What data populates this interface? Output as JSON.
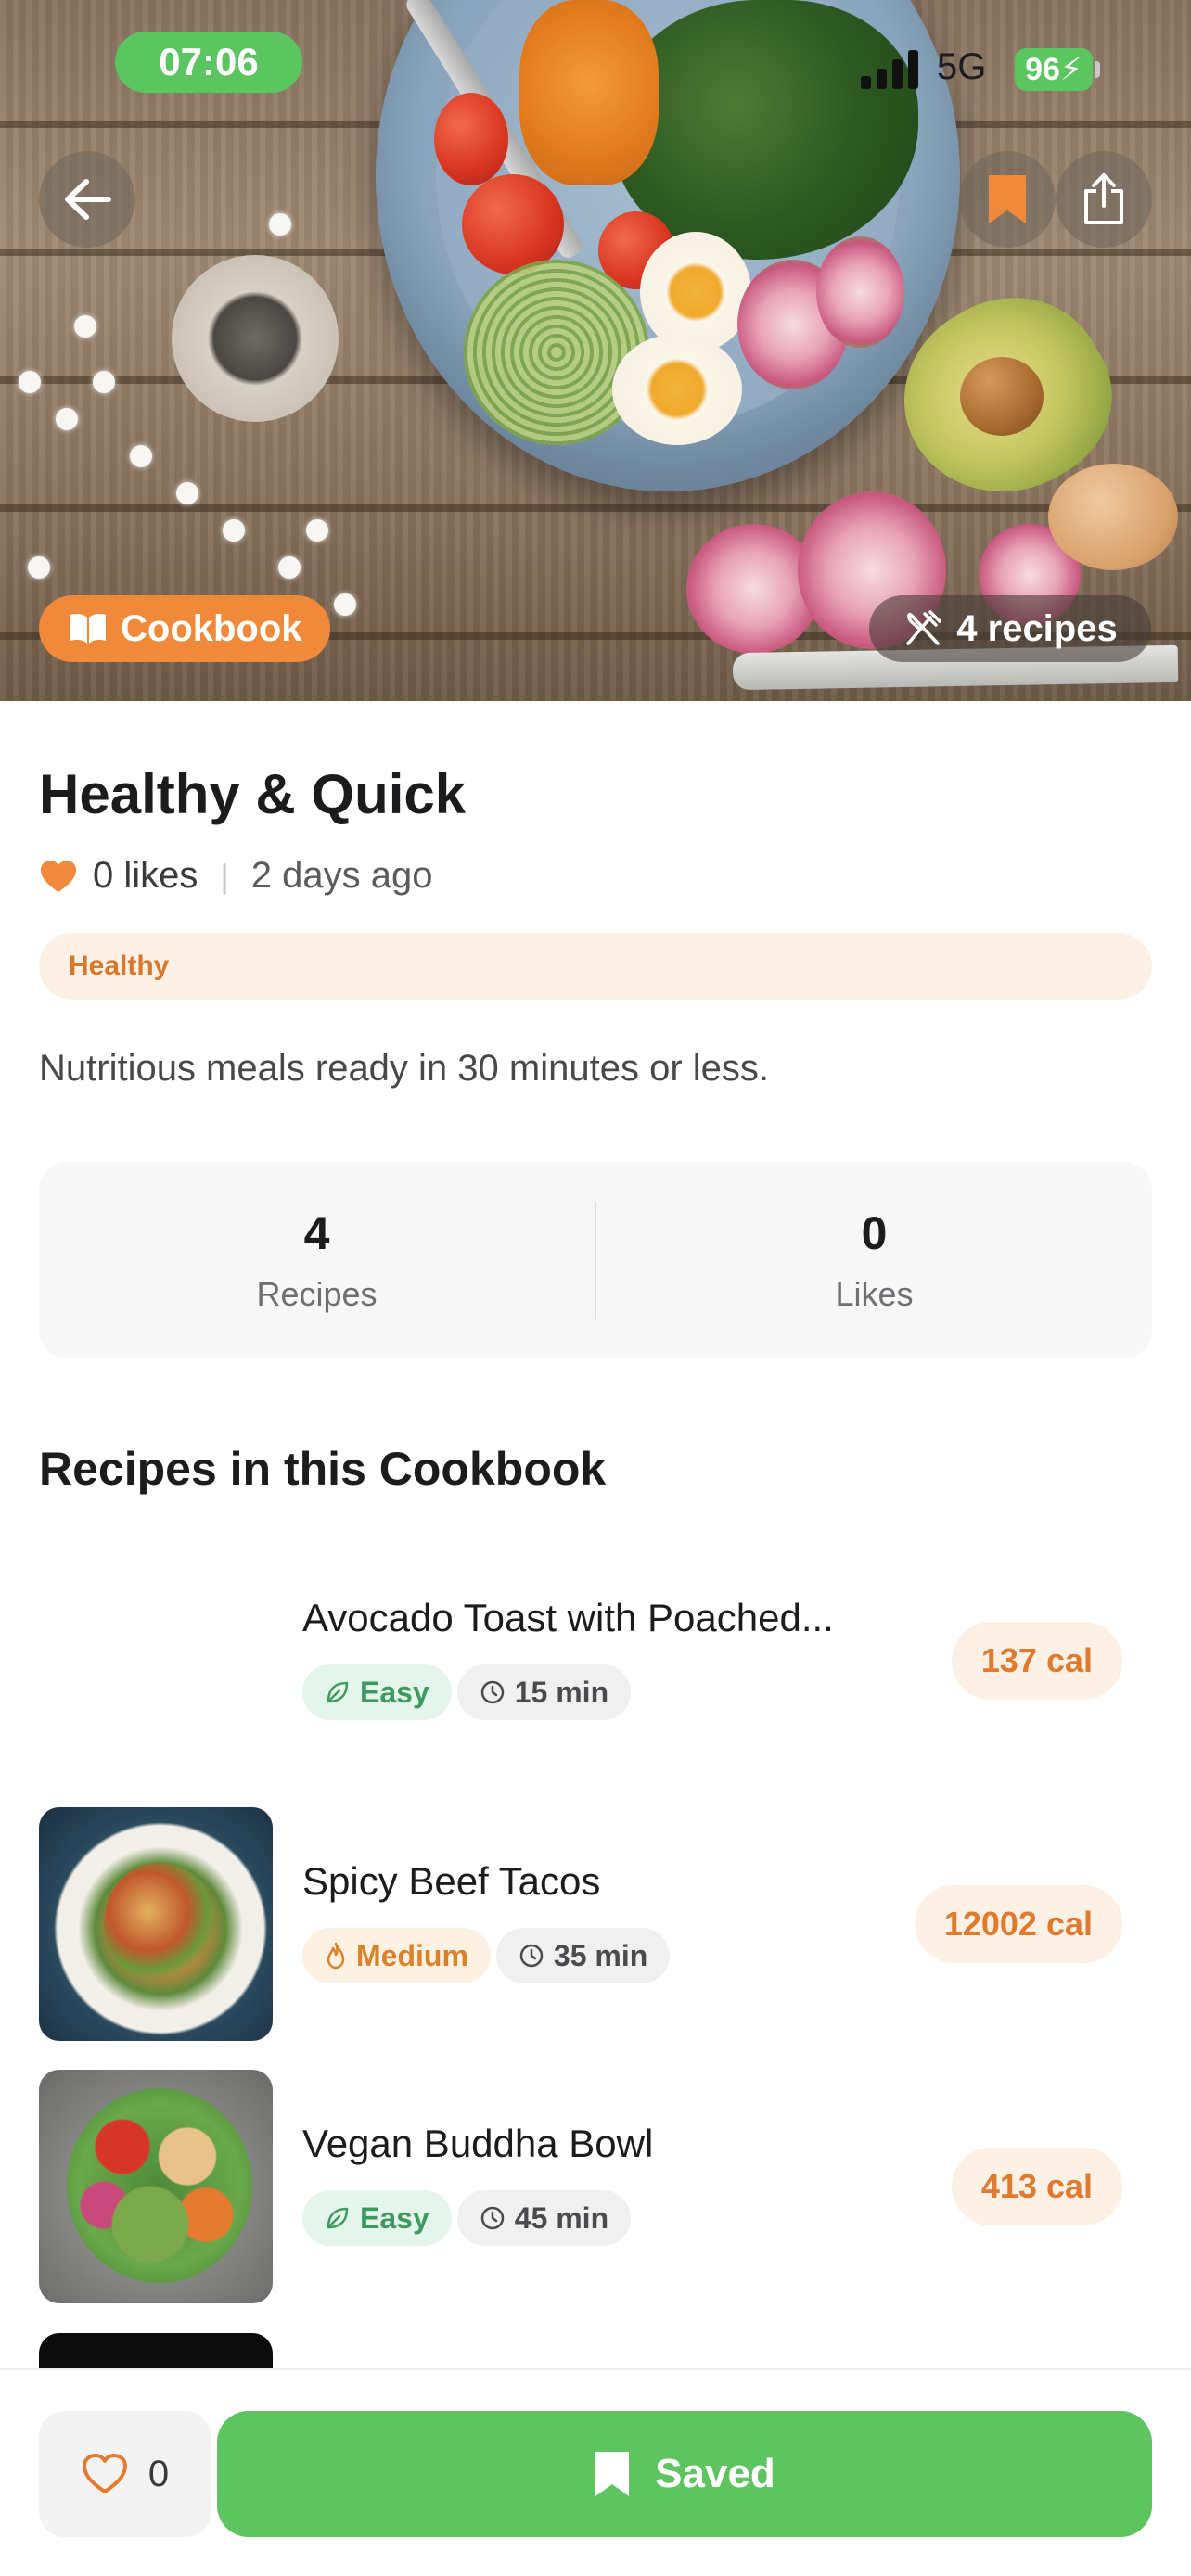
{
  "status_bar": {
    "time": "07:06",
    "network": "5G",
    "battery": "96"
  },
  "hero": {
    "badge_label": "Cookbook",
    "recipes_count_label": "4 recipes"
  },
  "cookbook": {
    "title": "Healthy & Quick",
    "likes_label": "0 likes",
    "posted": "2 days ago",
    "tag": "Healthy",
    "description": "Nutritious meals ready in 30 minutes or less."
  },
  "stats": [
    {
      "value": "4",
      "label": "Recipes"
    },
    {
      "value": "0",
      "label": "Likes"
    }
  ],
  "section_title": "Recipes in this Cookbook",
  "recipes": [
    {
      "name": "Avocado Toast with Poached...",
      "difficulty": "Easy",
      "time": "15 min",
      "calories": "137 cal"
    },
    {
      "name": "Spicy Beef Tacos",
      "difficulty": "Medium",
      "time": "35 min",
      "calories": "12002 cal"
    },
    {
      "name": "Vegan Buddha Bowl",
      "difficulty": "Easy",
      "time": "45 min",
      "calories": "413 cal"
    }
  ],
  "bottom_bar": {
    "like_count": "0",
    "saved_label": "Saved"
  },
  "colors": {
    "accent_orange": "#f08a3a",
    "accent_green": "#5dc460",
    "status_green": "#5bc560"
  },
  "icons": {
    "back": "arrow-left-icon",
    "bookmark": "bookmark-icon",
    "share": "share-icon",
    "cookbook": "open-book-icon",
    "recipes": "fork-knife-icon",
    "heart": "heart-icon",
    "leaf": "leaf-icon",
    "flame": "flame-icon",
    "clock": "clock-icon"
  }
}
